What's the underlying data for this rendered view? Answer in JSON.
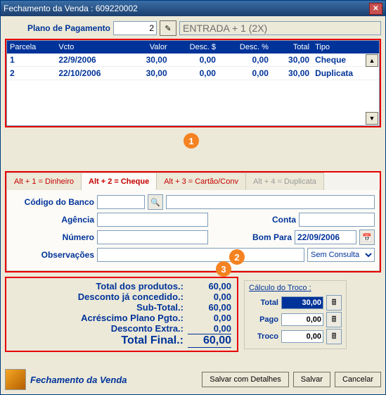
{
  "window": {
    "title": "Fechamento da Venda : 609220002"
  },
  "plano": {
    "label": "Plano de Pagamento",
    "value": "2",
    "plan_name": "ENTRADA + 1  (2X)"
  },
  "table": {
    "headers": {
      "parcela": "Parcela",
      "vcto": "Vcto",
      "valor": "Valor",
      "desc_v": "Desc. $",
      "desc_p": "Desc. %",
      "total": "Total",
      "tipo": "Tipo"
    },
    "rows": [
      {
        "parcela": "1",
        "vcto": "22/9/2006",
        "valor": "30,00",
        "desc_v": "0,00",
        "desc_p": "0,00",
        "total": "30,00",
        "tipo": "Cheque"
      },
      {
        "parcela": "2",
        "vcto": "22/10/2006",
        "valor": "30,00",
        "desc_v": "0,00",
        "desc_p": "0,00",
        "total": "30,00",
        "tipo": "Duplicata"
      }
    ]
  },
  "tabs": {
    "t1": "Alt + 1 = Dinheiro",
    "t2": "Alt + 2 = Cheque",
    "t3": "Alt + 3 = Cartão/Conv",
    "t4": "Alt + 4 = Duplicata"
  },
  "cheque": {
    "banco_label": "Código do Banco",
    "agencia_label": "Agência",
    "conta_label": "Conta",
    "numero_label": "Número",
    "bompara_label": "Bom Para",
    "bompara_value": "22/09/2006",
    "obs_label": "Observações",
    "consulta": "Sem Consulta"
  },
  "totals": {
    "l1_lbl": "Total dos produtos.:",
    "l1_val": "60,00",
    "l2_lbl": "Desconto já concedido.:",
    "l2_val": "0,00",
    "l3_lbl": "Sub-Total.:",
    "l3_val": "60,00",
    "l4_lbl": "Acréscimo Plano Pgto.:",
    "l4_val": "0,00",
    "l5_lbl": "Desconto Extra.:",
    "l5_val": "0,00",
    "l6_lbl": "Total Final.:",
    "l6_val": "60,00"
  },
  "troco": {
    "hdr": "Cálculo do Troco :",
    "total_lbl": "Total",
    "total_val": "30,00",
    "pago_lbl": "Pago",
    "pago_val": "0,00",
    "troco_lbl": "Troco",
    "troco_val": "0,00"
  },
  "footer": {
    "title": "Fechamento da Venda",
    "save_det": "Salvar com Detalhes",
    "save": "Salvar",
    "cancel": "Cancelar"
  },
  "callouts": {
    "c1": "1",
    "c2": "2",
    "c3": "3"
  }
}
